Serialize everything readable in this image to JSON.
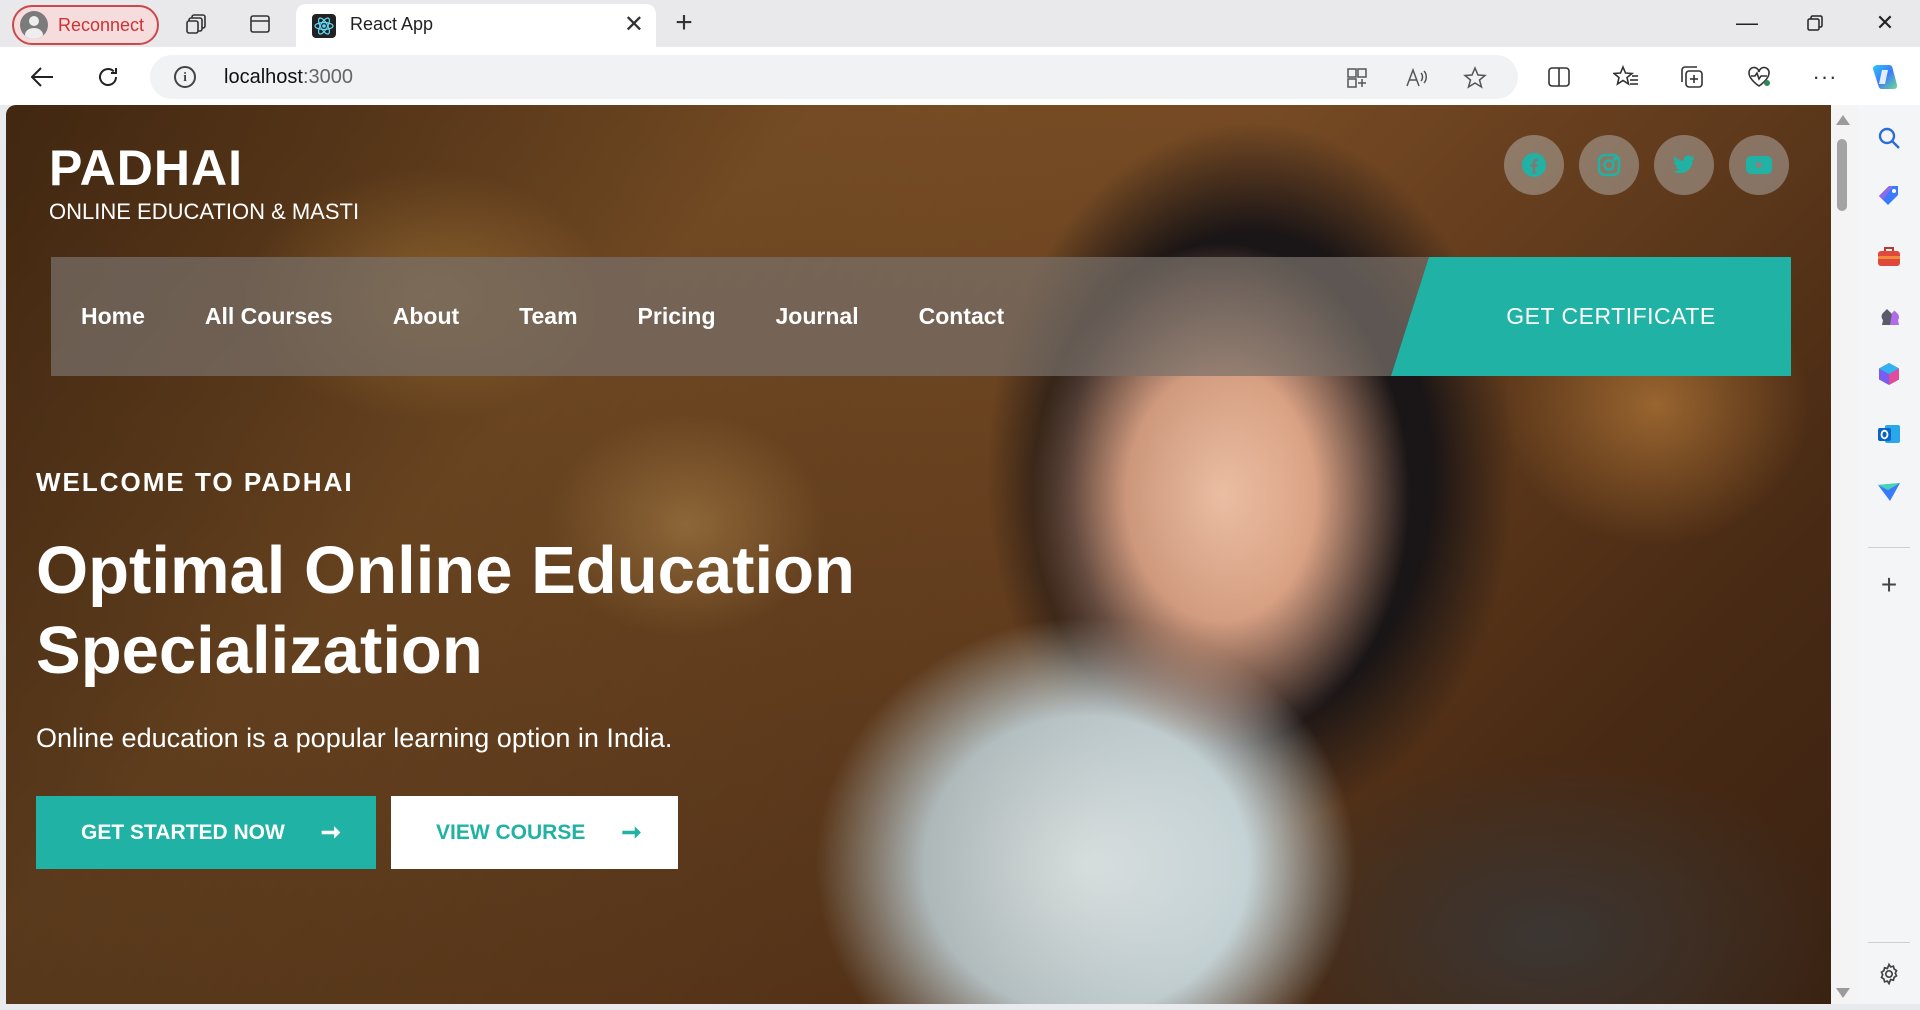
{
  "browser": {
    "profile_label": "Reconnect",
    "tab_title": "React App",
    "address_host": "localhost",
    "address_port": ":3000"
  },
  "site": {
    "brand_name": "PADHAI",
    "brand_tagline": "ONLINE EDUCATION & MASTI",
    "socials": [
      "facebook-icon",
      "instagram-icon",
      "twitter-icon",
      "youtube-icon"
    ],
    "menu": [
      {
        "label": "Home"
      },
      {
        "label": "All Courses"
      },
      {
        "label": "About"
      },
      {
        "label": "Team"
      },
      {
        "label": "Pricing"
      },
      {
        "label": "Journal"
      },
      {
        "label": "Contact"
      }
    ],
    "cta_label": "GET CERTIFICATE"
  },
  "hero": {
    "kicker": "WELCOME TO PADHAI",
    "title_line1": "Optimal Online Education",
    "title_line2": "Specialization",
    "subtitle": "Online education is a popular learning option in India.",
    "primary_button": "GET STARTED NOW",
    "secondary_button": "VIEW COURSE",
    "arrow": "➞"
  },
  "colors": {
    "accent": "#20b2a4",
    "menu_overlay": "#78706980",
    "reconnect_red": "#c94a4a"
  }
}
